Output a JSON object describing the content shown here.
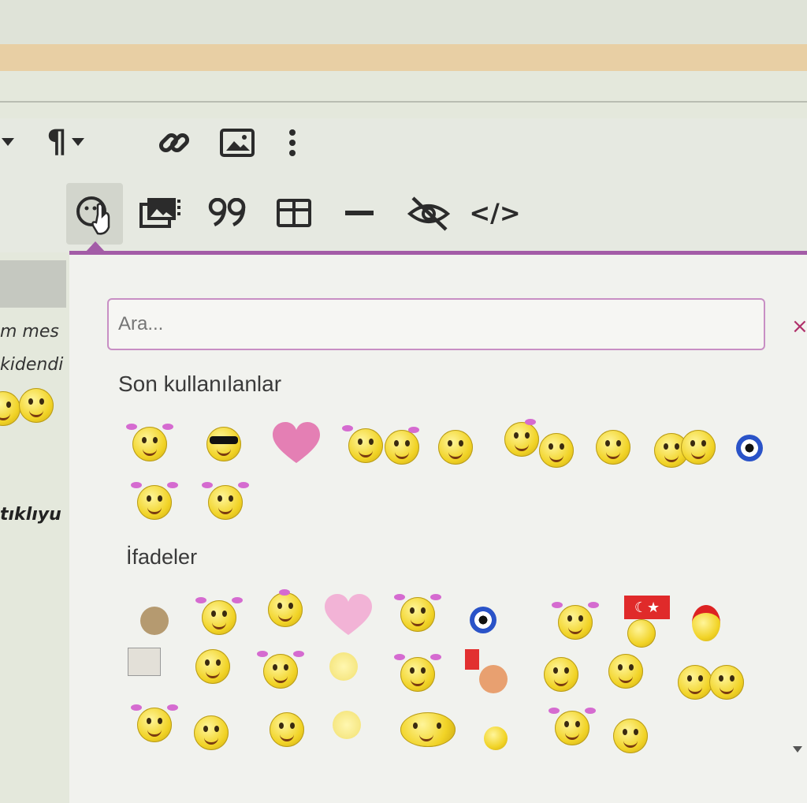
{
  "toolbar": {
    "row1": [
      "paragraph-format-dropdown",
      "insert-link",
      "insert-image",
      "more-options"
    ],
    "row2": [
      "emoji-picker",
      "insert-media",
      "insert-quote",
      "insert-table",
      "horizontal-rule",
      "spoiler-hide",
      "source-code"
    ],
    "paragraph_icon": "¶",
    "code_icon": "</>"
  },
  "left_text": {
    "line1": "m mes",
    "line2": "kidendi",
    "bold": "tıklıyu"
  },
  "picker": {
    "search_placeholder": "Ara...",
    "close_icon": "×",
    "recent_title": "Son kullanılanlar",
    "expressions_title": "İfadeler",
    "flag_symbol": "☾★"
  },
  "colors": {
    "accent": "#a35ca7",
    "heart": "#e47fb4",
    "toolbar_bg": "#e6e9e1",
    "gold_bar": "#e8cfa4"
  }
}
